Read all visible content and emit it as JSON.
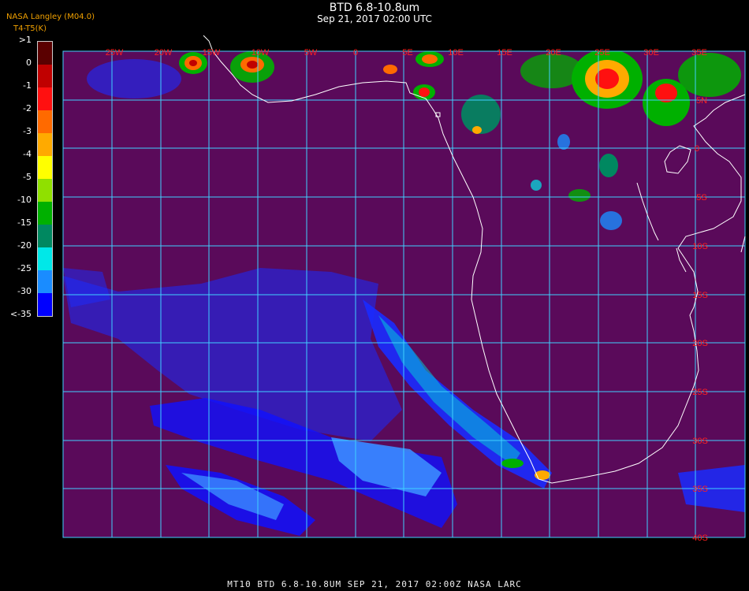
{
  "header": {
    "title": "BTD 6.8-10.8um",
    "subtitle": "Sep 21, 2017 02:00 UTC",
    "agency": "NASA Langley (M04.0)",
    "units": "T4-T5(K)"
  },
  "colorbar": {
    "labels": [
      ">1",
      "0",
      "-1",
      "-2",
      "-3",
      "-4",
      "-5",
      "-10",
      "-15",
      "-20",
      "-25",
      "-30",
      "<-35"
    ],
    "colors": [
      "#5a0000",
      "#c00000",
      "#ff1010",
      "#ff6a00",
      "#ffaa00",
      "#ffff00",
      "#90e000",
      "#00b000",
      "#008860",
      "#00e8e8",
      "#1a8cff",
      "#0000ff",
      "#5a0a5a"
    ]
  },
  "map": {
    "background_color": "#5a0a5a",
    "grid_color": "#40d0ff",
    "coast_color": "#ffffff",
    "label_color": "#ff2020",
    "lon_labels": [
      "25W",
      "20W",
      "15W",
      "10W",
      "5W",
      "0",
      "5E",
      "10E",
      "15E",
      "20E",
      "25E",
      "30E",
      "35E"
    ],
    "lat_labels": [
      "5N",
      "0",
      "5S",
      "10S",
      "15S",
      "20S",
      "25S",
      "30S",
      "35S",
      "40S"
    ]
  },
  "footer": {
    "text": "MT10  BTD 6.8-10.8UM   SEP 21, 2017 02:00Z   NASA LARC"
  }
}
